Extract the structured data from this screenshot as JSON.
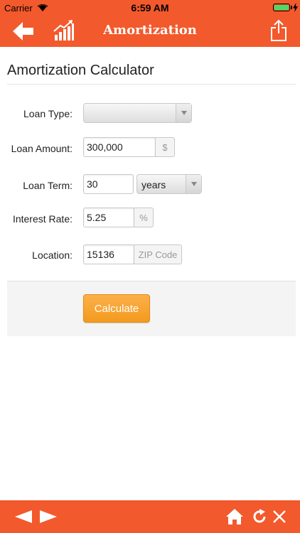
{
  "status_bar": {
    "carrier": "Carrier",
    "time": "6:59 AM"
  },
  "nav": {
    "title": "Amortization"
  },
  "page": {
    "heading": "Amortization Calculator"
  },
  "form": {
    "loan_type": {
      "label": "Loan Type:",
      "value": ""
    },
    "loan_amount": {
      "label": "Loan Amount:",
      "value": "300,000",
      "addon": "$"
    },
    "loan_term": {
      "label": "Loan Term:",
      "value": "30",
      "unit": "years"
    },
    "interest_rate": {
      "label": "Interest Rate:",
      "value": "5.25",
      "addon": "%"
    },
    "location": {
      "label": "Location:",
      "value": "15136",
      "addon": "ZIP Code"
    }
  },
  "actions": {
    "calculate": "Calculate"
  },
  "colors": {
    "brand": "#f2592c",
    "button": "#f7a233",
    "battery": "#4cd964"
  },
  "icons": {
    "nav_left": [
      "back-arrow-icon",
      "chart-icon"
    ],
    "nav_right": [
      "share-icon"
    ],
    "toolbar": [
      "triangle-left-icon",
      "triangle-right-icon",
      "home-icon",
      "refresh-icon",
      "close-icon"
    ]
  }
}
